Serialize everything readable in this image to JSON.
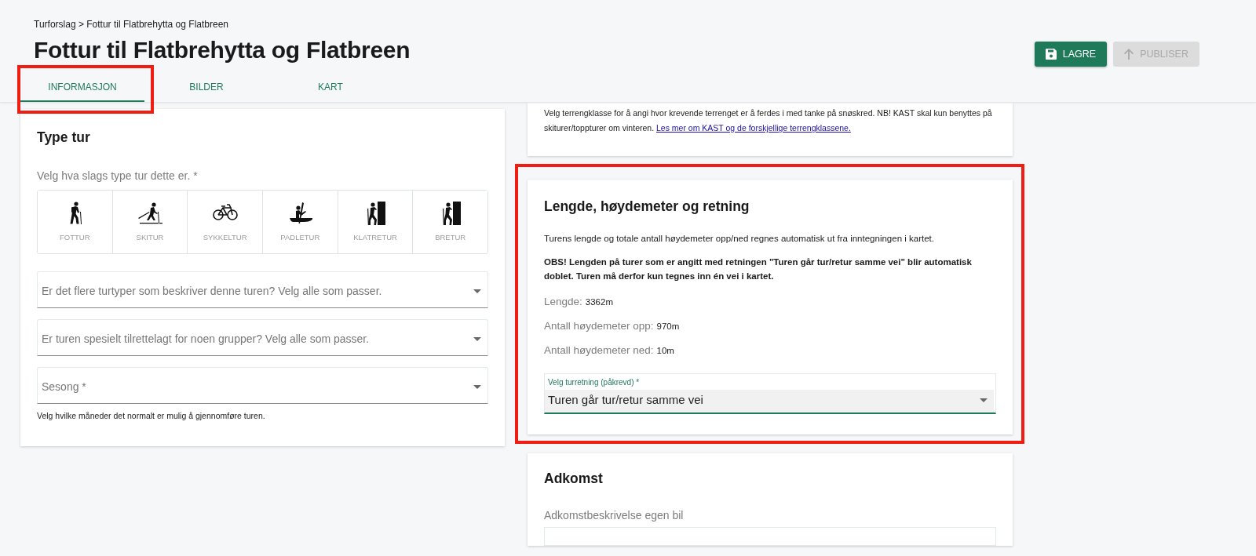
{
  "breadcrumb": "Turforslag > Fottur til Flatbrehytta og Flatbreen",
  "title": "Fottur til Flatbrehytta og Flatbreen",
  "actions": [
    {
      "label": "LAGRE",
      "kind": "save",
      "disabled": false
    },
    {
      "label": "PUBLISER",
      "kind": "publish",
      "disabled": true
    }
  ],
  "tabs": [
    {
      "label": "INFORMASJON",
      "selected": true,
      "highlighted": true
    },
    {
      "label": "BILDER",
      "selected": false,
      "highlighted": false
    },
    {
      "label": "KART",
      "selected": false,
      "highlighted": false
    }
  ],
  "type_card": {
    "title": "Type tur",
    "prompt": "Velg hva slags type tur dette er. *",
    "types": [
      {
        "label": "FOTTUR",
        "kind": "hiking",
        "selected": false
      },
      {
        "label": "SKITUR",
        "kind": "skiing",
        "selected": false
      },
      {
        "label": "SYKKELTUR",
        "kind": "cycling",
        "selected": false
      },
      {
        "label": "PADLETUR",
        "kind": "paddling",
        "selected": false
      },
      {
        "label": "KLATRETUR",
        "kind": "climbing",
        "selected": false
      },
      {
        "label": "BRETUR",
        "kind": "climbing",
        "selected": false
      }
    ],
    "selects": [
      {
        "placeholder": "Er det flere turtyper som beskriver denne turen? Velg alle som passer."
      },
      {
        "placeholder": "Er turen spesielt tilrettelagt for noen grupper? Velg alle som passer."
      },
      {
        "placeholder": "Sesong *",
        "helper": "Velg hvilke måneder det normalt er mulig å gjennomføre turen."
      }
    ]
  },
  "terrain_card": {
    "text": "Velg terrengklasse for å angi hvor krevende terrenget er å ferdes i med tanke på snøskred. NB! KAST skal kun benyttes på skiturer/toppturer om vinteren.",
    "link": "Les mer om KAST og de forskjellige terrengklassene."
  },
  "length_card": {
    "highlighted": true,
    "title": "Lengde, høydemeter og retning",
    "intro": "Turens lengde og totale antall høydemeter opp/ned regnes automatisk ut fra inntegningen i kartet.",
    "notice": "OBS! Lengden på turer som er angitt med retningen \"Turen går tur/retur samme vei\" blir automatisk doblet. Turen må derfor kun tegnes inn én vei i kartet.",
    "stats": [
      {
        "label": "Lengde:",
        "value": "3362m"
      },
      {
        "label": "Antall høydemeter opp:",
        "value": "970m"
      },
      {
        "label": "Antall høydemeter ned:",
        "value": "10m"
      }
    ],
    "direction": {
      "label": "Velg turretning (påkrevd) *",
      "value": "Turen går tur/retur samme vei"
    }
  },
  "access_card": {
    "title": "Adkomst",
    "field_label": "Adkomstbeskrivelse egen bil"
  }
}
